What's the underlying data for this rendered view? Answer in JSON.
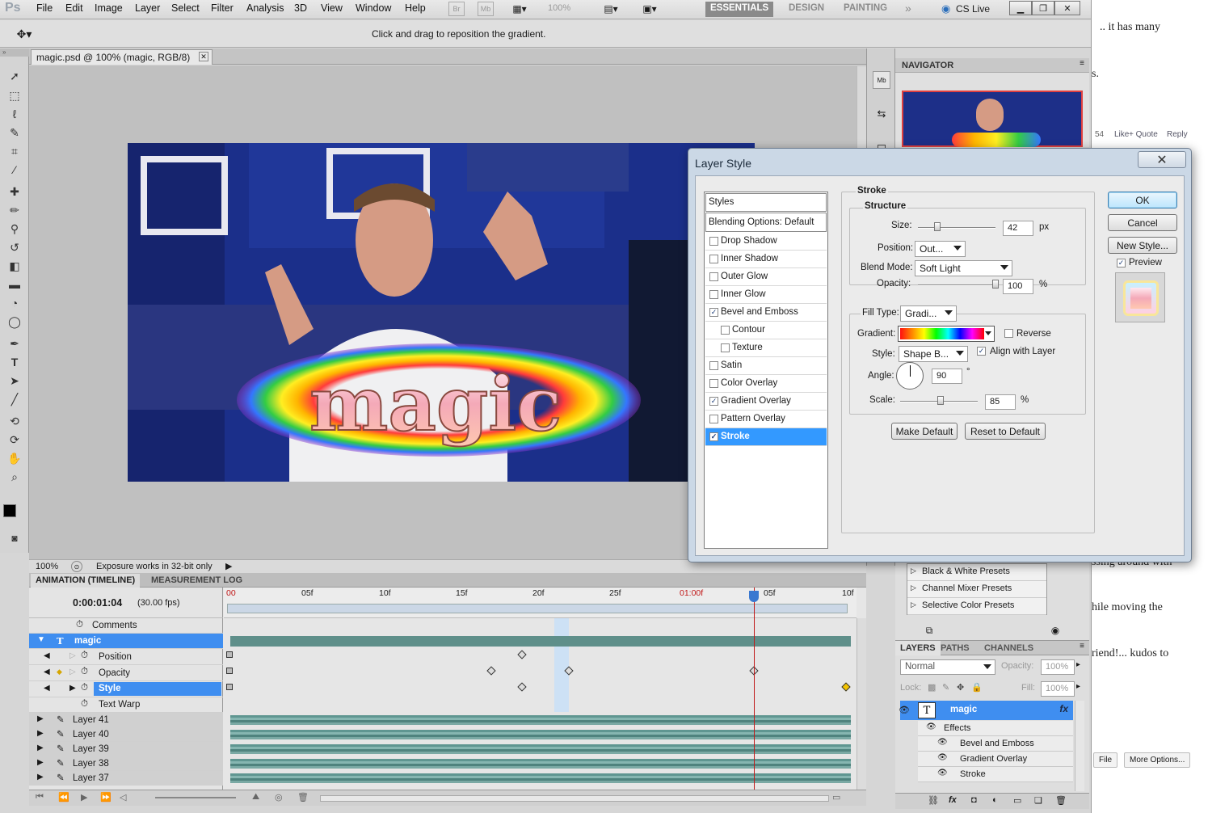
{
  "app": {
    "logo": "Ps"
  },
  "menu": [
    "File",
    "Edit",
    "Image",
    "Layer",
    "Select",
    "Filter",
    "Analysis",
    "3D",
    "View",
    "Window",
    "Help"
  ],
  "app_bar": {
    "bridge": "Br",
    "mini_bridge": "Mb",
    "zoom": "100%"
  },
  "workspaces": [
    "ESSENTIALS",
    "DESIGN",
    "PAINTING"
  ],
  "cs_live": "CS Live",
  "options_hint": "Click and drag to reposition the gradient.",
  "document": {
    "tab_title": "magic.psd @ 100% (magic, RGB/8)",
    "text": "magic"
  },
  "status": {
    "zoom": "100%",
    "message": "Exposure works in 32-bit only"
  },
  "timeline": {
    "tabs": [
      "ANIMATION (TIMELINE)",
      "MEASUREMENT LOG"
    ],
    "timecode": "0:00:01:04",
    "fps": "(30.00 fps)",
    "ruler": [
      "00",
      "05f",
      "10f",
      "15f",
      "20f",
      "25f",
      "01:00f",
      "05f",
      "10f"
    ],
    "rows": [
      {
        "label": "Comments"
      },
      {
        "label": "magic"
      },
      {
        "label": "Position"
      },
      {
        "label": "Opacity"
      },
      {
        "label": "Style"
      },
      {
        "label": "Text Warp"
      },
      {
        "label": "Layer 41"
      },
      {
        "label": "Layer 40"
      },
      {
        "label": "Layer 39"
      },
      {
        "label": "Layer 38"
      },
      {
        "label": "Layer 37"
      }
    ]
  },
  "navigator": {
    "title": "NAVIGATOR"
  },
  "adjustment_presets": [
    "Black & White Presets",
    "Channel Mixer Presets",
    "Selective Color Presets"
  ],
  "layers_panel": {
    "tabs": [
      "LAYERS",
      "PATHS",
      "CHANNELS"
    ],
    "blend_mode": "Normal",
    "opacity_label": "Opacity:",
    "opacity": "100%",
    "lock_label": "Lock:",
    "fill_label": "Fill:",
    "fill": "100%",
    "layer_name": "magic",
    "effects_label": "Effects",
    "effects": [
      "Bevel and Emboss",
      "Gradient Overlay",
      "Stroke"
    ]
  },
  "dialog": {
    "title": "Layer Style",
    "styles_header": "Styles",
    "blending": "Blending Options: Default",
    "styles": [
      {
        "label": "Drop Shadow",
        "checked": false,
        "indent": false
      },
      {
        "label": "Inner Shadow",
        "checked": false,
        "indent": false
      },
      {
        "label": "Outer Glow",
        "checked": false,
        "indent": false
      },
      {
        "label": "Inner Glow",
        "checked": false,
        "indent": false
      },
      {
        "label": "Bevel and Emboss",
        "checked": true,
        "indent": false
      },
      {
        "label": "Contour",
        "checked": false,
        "indent": true
      },
      {
        "label": "Texture",
        "checked": false,
        "indent": true
      },
      {
        "label": "Satin",
        "checked": false,
        "indent": false
      },
      {
        "label": "Color Overlay",
        "checked": false,
        "indent": false
      },
      {
        "label": "Gradient Overlay",
        "checked": true,
        "indent": false
      },
      {
        "label": "Pattern Overlay",
        "checked": false,
        "indent": false
      },
      {
        "label": "Stroke",
        "checked": true,
        "indent": false,
        "selected": true
      }
    ],
    "section": "Stroke",
    "structure": "Structure",
    "size_label": "Size:",
    "size": "42",
    "size_unit": "px",
    "position_label": "Position:",
    "position": "Out...",
    "blend_label": "Blend Mode:",
    "blend": "Soft Light",
    "opacity_label": "Opacity:",
    "opacity": "100",
    "opacity_unit": "%",
    "fill_type_label": "Fill Type:",
    "fill_type": "Gradi...",
    "gradient_label": "Gradient:",
    "reverse": "Reverse",
    "style_label": "Style:",
    "style": "Shape B...",
    "align": "Align with Layer",
    "angle_label": "Angle:",
    "angle": "90",
    "angle_unit": "°",
    "scale_label": "Scale:",
    "scale": "85",
    "scale_unit": "%",
    "make_default": "Make Default",
    "reset_default": "Reset to Default",
    "ok": "OK",
    "cancel": "Cancel",
    "new_style": "New Style...",
    "preview": "Preview",
    "values": {
      "size_fraction": 0.07,
      "opacity_fraction": 1.0,
      "scale_fraction": 0.85,
      "angle_deg": 90
    }
  },
  "webpage": {
    "text1": ".. it has many",
    "text2": "s.",
    "actions": [
      "54",
      "Like",
      "+ Quote",
      "Reply"
    ],
    "text3": "ssing around with",
    "text4": "hile moving the",
    "text5": "riend!... kudos to",
    "buttons": [
      "File",
      "More Options..."
    ]
  },
  "colors": {
    "selection": "#3399ff",
    "timeline_selection": "#3f8ef0",
    "track": "#5f9691",
    "playhead": "#c01818"
  }
}
